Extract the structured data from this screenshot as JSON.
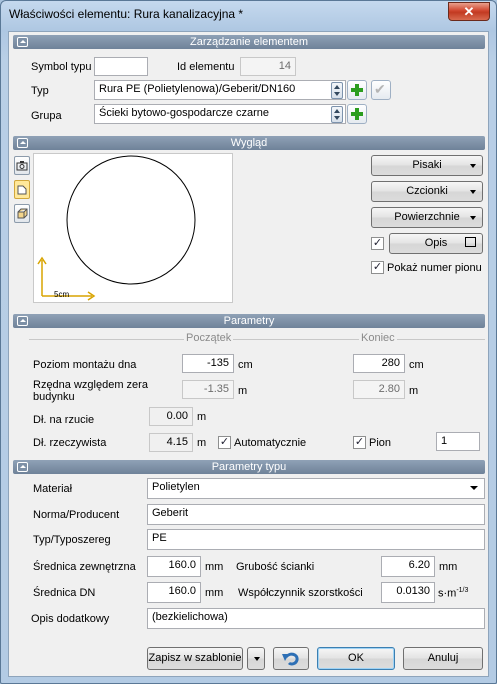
{
  "window": {
    "title": "Właściwości elementu: Rura kanalizacyjna *",
    "close_label": "✕"
  },
  "sections": {
    "management": "Zarządzanie elementem",
    "appearance": "Wygląd",
    "parameters": "Parametry",
    "type_parameters": "Parametry typu"
  },
  "management": {
    "type_symbol_label": "Symbol typu",
    "type_symbol_value": "",
    "element_id_label": "Id elementu",
    "element_id_value": "14",
    "type_label": "Typ",
    "type_value": "Rura PE (Polietylenowa)/Geberit/DN160",
    "group_label": "Grupa",
    "group_value": "Ścieki bytowo-gospodarcze czarne"
  },
  "appearance": {
    "pens_label": "Pisaki",
    "fonts_label": "Czcionki",
    "surfaces_label": "Powierzchnie",
    "description_label": "Opis",
    "description_checked": true,
    "show_riser_number_label": "Pokaż numer pionu",
    "show_riser_number_checked": true,
    "scale_label": "5cm",
    "icons": [
      "camera-icon",
      "plan-view-icon",
      "3d-view-icon"
    ]
  },
  "parameters": {
    "start_header": "Początek",
    "end_header": "Koniec",
    "bottom_level_label": "Poziom montażu dna",
    "bottom_level_start": "-135",
    "bottom_level_end": "280",
    "unit_cm": "cm",
    "ordinate_label": "Rzędna względem zera budynku",
    "ordinate_start": "-1.35",
    "ordinate_end": "2.80",
    "unit_m": "m",
    "projected_length_label": "Dł. na rzucie",
    "projected_length_value": "0.00",
    "actual_length_label": "Dł. rzeczywista",
    "actual_length_value": "4.15",
    "automatic_label": "Automatycznie",
    "automatic_checked": true,
    "riser_label": "Pion",
    "riser_checked": true,
    "riser_value": "1"
  },
  "type_parameters": {
    "material_label": "Materiał",
    "material_value": "Polietylen",
    "standard_label": "Norma/Producent",
    "standard_value": "Geberit",
    "series_label": "Typ/Typoszereg",
    "series_value": "PE",
    "outer_diameter_label": "Średnica zewnętrzna",
    "outer_diameter_value": "160.0",
    "unit_mm": "mm",
    "wall_thickness_label": "Grubość ścianki",
    "wall_thickness_value": "6.20",
    "dn_label": "Średnica DN",
    "dn_value": "160.0",
    "roughness_label": "Współczynnik szorstkości",
    "roughness_value": "0.0130",
    "roughness_unit": "s·m",
    "roughness_exp": "-1/3",
    "extra_desc_label": "Opis dodatkowy",
    "extra_desc_value": "(bezkielichowa)"
  },
  "footer": {
    "save_template_label": "Zapisz w szablonie",
    "ok_label": "OK",
    "cancel_label": "Anuluj"
  },
  "colors": {
    "accent_green": "#2b9d1e",
    "section_bar": "#7d90a6",
    "undo_blue": "#2d6fb5"
  }
}
